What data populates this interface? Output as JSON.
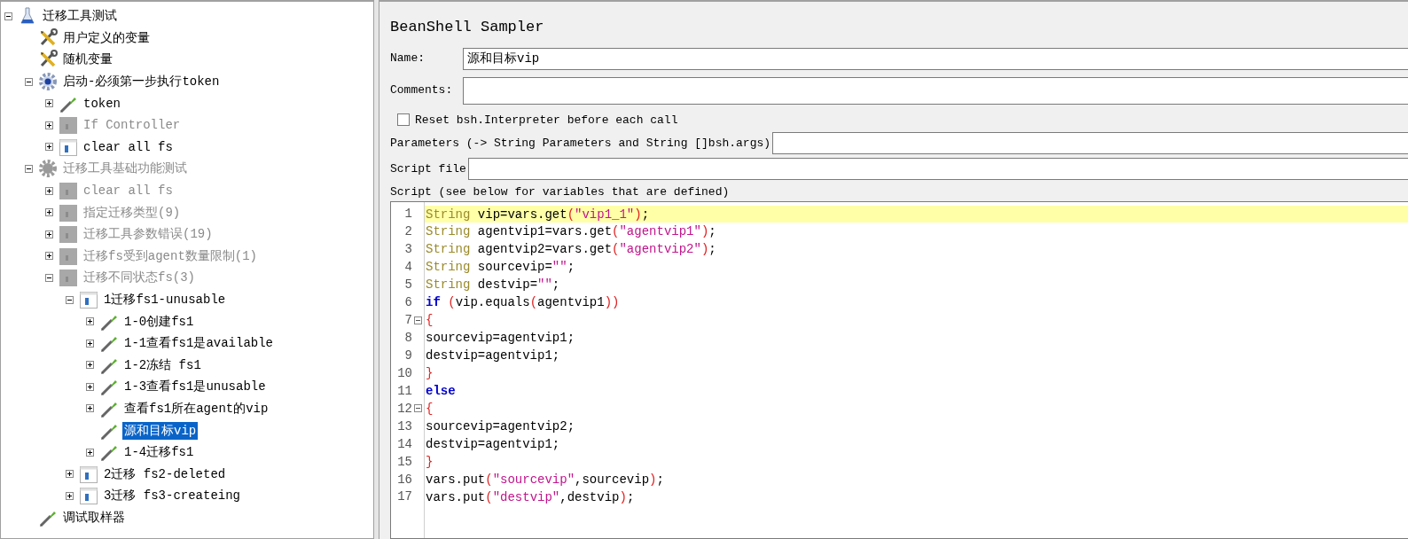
{
  "tree": [
    {
      "label": "迁移工具测试",
      "kind": "plan",
      "expanded": true,
      "disabled": false,
      "selected": false,
      "children": [
        {
          "label": "用户定义的变量",
          "kind": "config",
          "disabled": false,
          "selected": false
        },
        {
          "label": "随机变量",
          "kind": "config",
          "disabled": false,
          "selected": false
        },
        {
          "label": "启动-必须第一步执行token",
          "kind": "threadgroup",
          "expanded": true,
          "disabled": false,
          "selected": false,
          "children": [
            {
              "label": "token",
              "kind": "sampler",
              "expanded": false,
              "disabled": false,
              "selected": false
            },
            {
              "label": "If Controller",
              "kind": "controller",
              "expanded": false,
              "disabled": true,
              "selected": false
            },
            {
              "label": "clear all fs",
              "kind": "controller",
              "expanded": false,
              "disabled": false,
              "selected": false
            }
          ]
        },
        {
          "label": "迁移工具基础功能测试",
          "kind": "threadgroup",
          "expanded": true,
          "disabled": true,
          "selected": false,
          "children": [
            {
              "label": "clear all fs",
              "kind": "controller",
              "expanded": false,
              "disabled": true,
              "selected": false
            },
            {
              "label": "指定迁移类型(9)",
              "kind": "controller",
              "expanded": false,
              "disabled": true,
              "selected": false
            },
            {
              "label": "迁移工具参数错误(19)",
              "kind": "controller",
              "expanded": false,
              "disabled": true,
              "selected": false
            },
            {
              "label": "迁移fs受到agent数量限制(1)",
              "kind": "controller",
              "expanded": false,
              "disabled": true,
              "selected": false
            },
            {
              "label": "迁移不同状态fs(3)",
              "kind": "controller",
              "expanded": true,
              "disabled": true,
              "selected": false,
              "children": [
                {
                  "label": "1迁移fs1-unusable",
                  "kind": "controller",
                  "expanded": true,
                  "disabled": false,
                  "selected": false,
                  "children": [
                    {
                      "label": "1-0创建fs1",
                      "kind": "sampler",
                      "expanded": false,
                      "disabled": false,
                      "selected": false
                    },
                    {
                      "label": "1-1查看fs1是available",
                      "kind": "sampler",
                      "expanded": false,
                      "disabled": false,
                      "selected": false
                    },
                    {
                      "label": "1-2冻结 fs1",
                      "kind": "sampler",
                      "expanded": false,
                      "disabled": false,
                      "selected": false
                    },
                    {
                      "label": "1-3查看fs1是unusable",
                      "kind": "sampler",
                      "expanded": false,
                      "disabled": false,
                      "selected": false
                    },
                    {
                      "label": "查看fs1所在agent的vip",
                      "kind": "sampler",
                      "expanded": false,
                      "disabled": false,
                      "selected": false
                    },
                    {
                      "label": "源和目标vip",
                      "kind": "sampler",
                      "disabled": false,
                      "selected": true
                    },
                    {
                      "label": "1-4迁移fs1",
                      "kind": "sampler",
                      "expanded": false,
                      "disabled": false,
                      "selected": false
                    }
                  ]
                },
                {
                  "label": "2迁移 fs2-deleted",
                  "kind": "controller",
                  "expanded": false,
                  "disabled": false,
                  "selected": false
                },
                {
                  "label": "3迁移 fs3-createing",
                  "kind": "controller",
                  "expanded": false,
                  "disabled": false,
                  "selected": false
                }
              ]
            }
          ]
        },
        {
          "label": "调试取样器",
          "kind": "sampler",
          "disabled": false,
          "selected": false
        }
      ]
    }
  ],
  "panel": {
    "title": "BeanShell Sampler",
    "name_label": "Name:",
    "name_value": "源和目标vip",
    "comments_label": "Comments:",
    "reset_checkbox": {
      "label": "Reset bsh.Interpreter before each call",
      "checked": false
    },
    "parameters_label": "Parameters (-> String Parameters and String []bsh.args)",
    "script_file_label": "Script file",
    "script_label": "Script (see below for variables that are defined)"
  },
  "code": [
    {
      "number": "1",
      "current": true,
      "foldable": false,
      "tokens": [
        {
          "kind": "type",
          "text": "String"
        },
        {
          "kind": "plain",
          "text": " vip=vars.get"
        },
        {
          "kind": "bracket",
          "text": "("
        },
        {
          "kind": "string",
          "text": "\"vip1_1\""
        },
        {
          "kind": "bracket",
          "text": ")"
        },
        {
          "kind": "plain",
          "text": ";"
        }
      ]
    },
    {
      "number": "2",
      "current": false,
      "foldable": false,
      "tokens": [
        {
          "kind": "type",
          "text": "String"
        },
        {
          "kind": "plain",
          "text": " agentvip1=vars.get"
        },
        {
          "kind": "bracket",
          "text": "("
        },
        {
          "kind": "string",
          "text": "\"agentvip1\""
        },
        {
          "kind": "bracket",
          "text": ")"
        },
        {
          "kind": "plain",
          "text": ";"
        }
      ]
    },
    {
      "number": "3",
      "current": false,
      "foldable": false,
      "tokens": [
        {
          "kind": "type",
          "text": "String"
        },
        {
          "kind": "plain",
          "text": " agentvip2=vars.get"
        },
        {
          "kind": "bracket",
          "text": "("
        },
        {
          "kind": "string",
          "text": "\"agentvip2\""
        },
        {
          "kind": "bracket",
          "text": ")"
        },
        {
          "kind": "plain",
          "text": ";"
        }
      ]
    },
    {
      "number": "4",
      "current": false,
      "foldable": false,
      "tokens": [
        {
          "kind": "type",
          "text": "String"
        },
        {
          "kind": "plain",
          "text": " sourcevip="
        },
        {
          "kind": "string",
          "text": "\"\""
        },
        {
          "kind": "plain",
          "text": ";"
        }
      ]
    },
    {
      "number": "5",
      "current": false,
      "foldable": false,
      "tokens": [
        {
          "kind": "type",
          "text": "String"
        },
        {
          "kind": "plain",
          "text": " destvip="
        },
        {
          "kind": "string",
          "text": "\"\""
        },
        {
          "kind": "plain",
          "text": ";"
        }
      ]
    },
    {
      "number": "6",
      "current": false,
      "foldable": false,
      "tokens": [
        {
          "kind": "keyword",
          "text": "if"
        },
        {
          "kind": "bracket",
          "text": " ("
        },
        {
          "kind": "plain",
          "text": "vip.equals"
        },
        {
          "kind": "bracket",
          "text": "("
        },
        {
          "kind": "plain",
          "text": "agentvip1"
        },
        {
          "kind": "bracket",
          "text": "))"
        }
      ]
    },
    {
      "number": "7",
      "current": false,
      "foldable": true,
      "tokens": [
        {
          "kind": "bracket",
          "text": "{"
        }
      ]
    },
    {
      "number": "8",
      "current": false,
      "foldable": false,
      "tokens": [
        {
          "kind": "plain",
          "text": "sourcevip=agentvip1;"
        }
      ]
    },
    {
      "number": "9",
      "current": false,
      "foldable": false,
      "tokens": [
        {
          "kind": "plain",
          "text": "destvip=agentvip1;"
        }
      ]
    },
    {
      "number": "10",
      "current": false,
      "foldable": false,
      "tokens": [
        {
          "kind": "bracket",
          "text": "}"
        }
      ]
    },
    {
      "number": "11",
      "current": false,
      "foldable": false,
      "tokens": [
        {
          "kind": "keyword",
          "text": "else"
        }
      ]
    },
    {
      "number": "12",
      "current": false,
      "foldable": true,
      "tokens": [
        {
          "kind": "bracket",
          "text": "{"
        }
      ]
    },
    {
      "number": "13",
      "current": false,
      "foldable": false,
      "tokens": [
        {
          "kind": "plain",
          "text": "sourcevip=agentvip2;"
        }
      ]
    },
    {
      "number": "14",
      "current": false,
      "foldable": false,
      "tokens": [
        {
          "kind": "plain",
          "text": "destvip=agentvip1;"
        }
      ]
    },
    {
      "number": "15",
      "current": false,
      "foldable": false,
      "tokens": [
        {
          "kind": "bracket",
          "text": "}"
        }
      ]
    },
    {
      "number": "16",
      "current": false,
      "foldable": false,
      "tokens": [
        {
          "kind": "plain",
          "text": "vars.put"
        },
        {
          "kind": "bracket",
          "text": "("
        },
        {
          "kind": "string",
          "text": "\"sourcevip\""
        },
        {
          "kind": "plain",
          "text": ",sourcevip"
        },
        {
          "kind": "bracket",
          "text": ")"
        },
        {
          "kind": "plain",
          "text": ";"
        }
      ]
    },
    {
      "number": "17",
      "current": false,
      "foldable": false,
      "tokens": [
        {
          "kind": "plain",
          "text": "vars.put"
        },
        {
          "kind": "bracket",
          "text": "("
        },
        {
          "kind": "string",
          "text": "\"destvip\""
        },
        {
          "kind": "plain",
          "text": ",destvip"
        },
        {
          "kind": "bracket",
          "text": ")"
        },
        {
          "kind": "plain",
          "text": ";"
        }
      ]
    }
  ]
}
